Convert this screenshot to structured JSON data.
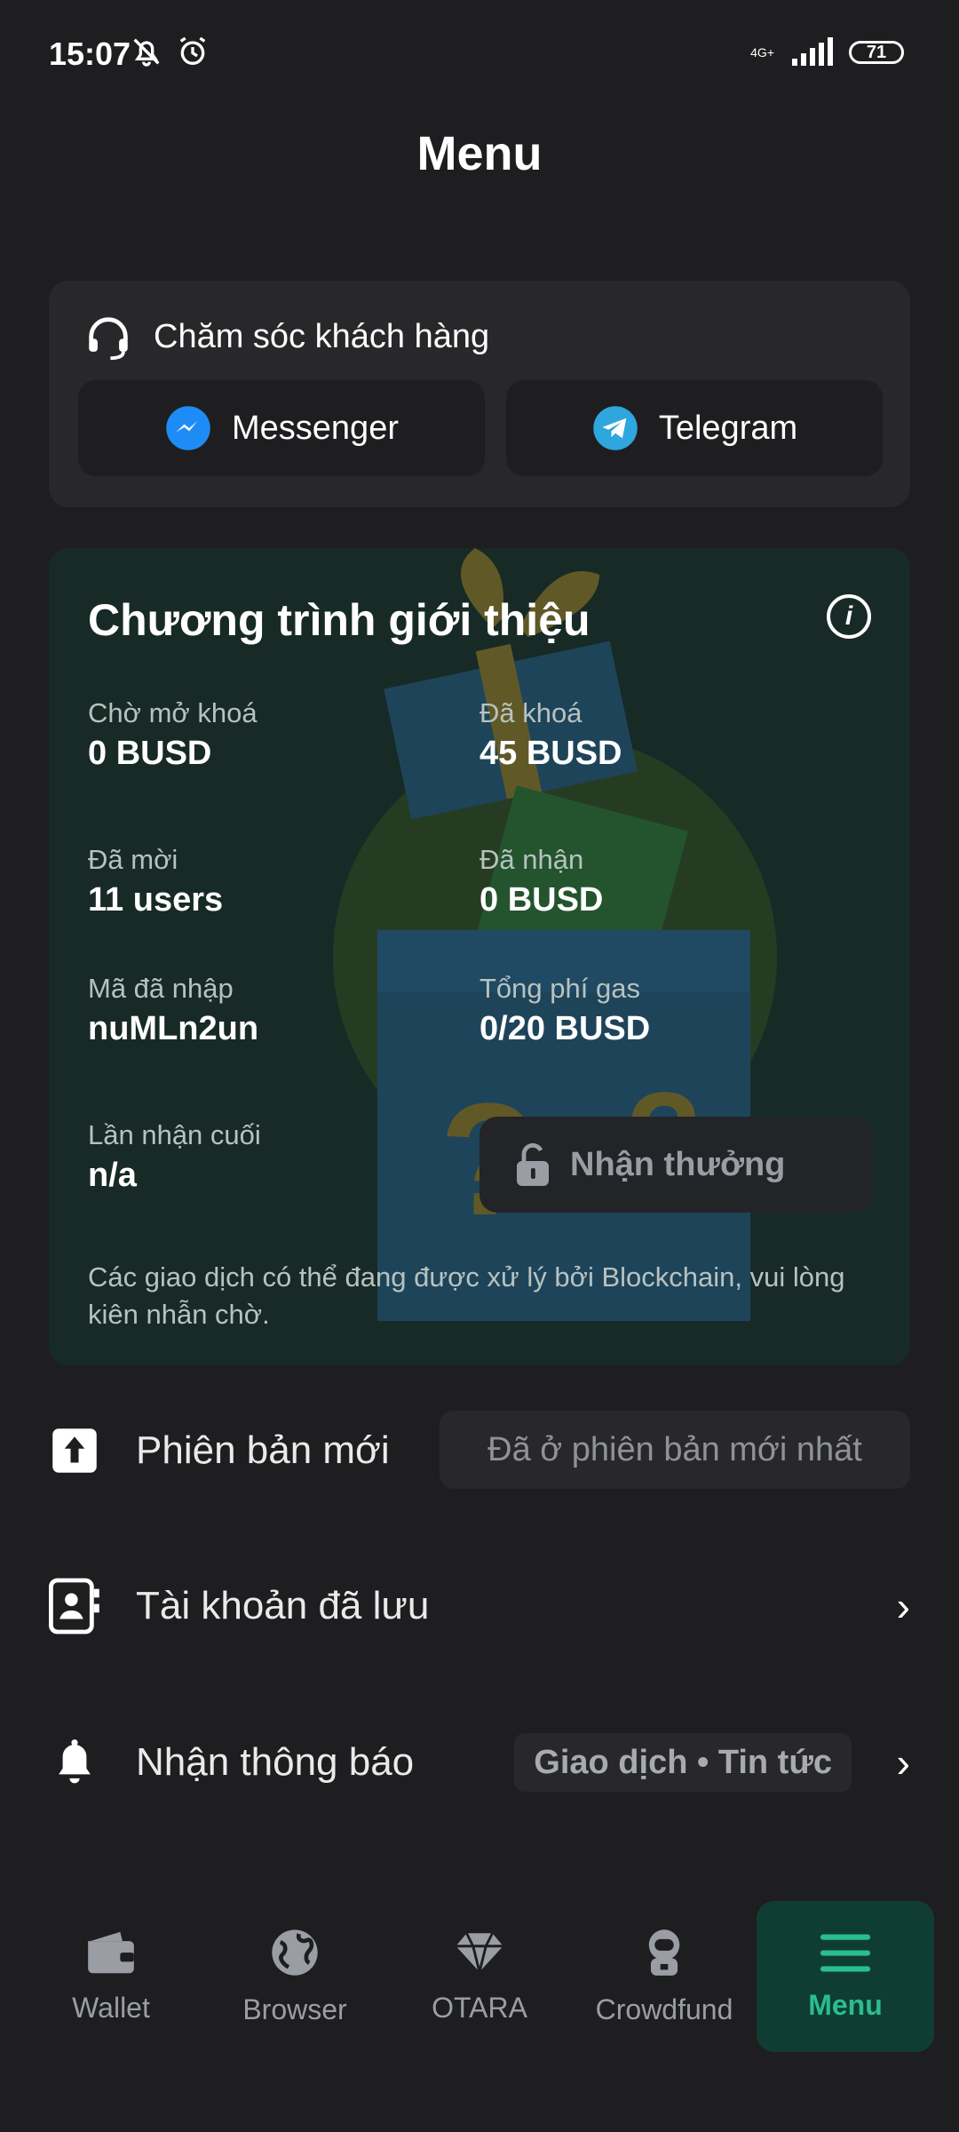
{
  "status_bar": {
    "time": "15:07",
    "network": "4G+",
    "battery": "71"
  },
  "page_title": "Menu",
  "customer_care": {
    "title": "Chăm sóc khách hàng",
    "messenger_label": "Messenger",
    "telegram_label": "Telegram"
  },
  "referral": {
    "title": "Chương trình giới thiệu",
    "pending_unlock": {
      "label": "Chờ mở khoá",
      "value": "0 BUSD"
    },
    "locked": {
      "label": "Đã khoá",
      "value": "45 BUSD"
    },
    "invited": {
      "label": "Đã mời",
      "value": "11 users"
    },
    "received": {
      "label": "Đã nhận",
      "value": "0 BUSD"
    },
    "code_entered": {
      "label": "Mã đã nhập",
      "value": "nuMLn2un"
    },
    "gas_fee": {
      "label": "Tổng phí gas",
      "value": "0/20 BUSD"
    },
    "last_received": {
      "label": "Lần nhận cuối",
      "value": "n/a"
    },
    "claim_button": "Nhận thưởng",
    "note": "Các giao dịch có thể đang được xử lý bởi Blockchain, vui lòng kiên nhẫn chờ."
  },
  "settings": {
    "new_version": {
      "label": "Phiên bản mới",
      "status": "Đã ở phiên bản mới nhất"
    },
    "saved_accounts": {
      "label": "Tài khoản đã lưu"
    },
    "notifications": {
      "label": "Nhận thông báo",
      "value": "Giao dịch • Tin tức"
    }
  },
  "bottom_nav": {
    "wallet": "Wallet",
    "browser": "Browser",
    "otara": "OTARA",
    "crowdfund": "Crowdfund",
    "menu": "Menu"
  },
  "colors": {
    "accent": "#2bbd8e",
    "card": "#28282b",
    "referral_bg": "#172a26",
    "active_nav_bg": "#0f3d33"
  }
}
